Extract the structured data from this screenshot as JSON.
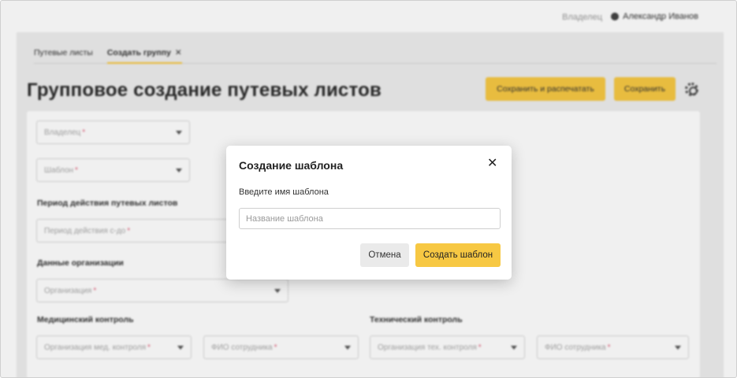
{
  "header": {
    "owner_label": "Владелец",
    "user_name": "Александр Иванов"
  },
  "tabs": [
    {
      "label": "Путевые листы"
    },
    {
      "label": "Создать группу",
      "close": "✕"
    }
  ],
  "page": {
    "title": "Групповое создание путевых листов",
    "save_print_label": "Сохранить и распечатать",
    "save_label": "Сохранить"
  },
  "form": {
    "owner_placeholder": "Владелец",
    "template_placeholder": "Шаблон",
    "period_section": "Период действия путевых листов",
    "period_placeholder": "Период действия с-до",
    "org_section": "Данные организации",
    "org_placeholder": "Организация",
    "med_section": "Медицинский контроль",
    "med_org_placeholder": "Организация мед. контроля",
    "med_employee_placeholder": "ФИО сотрудника",
    "tech_section": "Технический контроль",
    "tech_org_placeholder": "Организация тех. контроля",
    "tech_employee_placeholder": "ФИО сотрудника",
    "required_mark": "*"
  },
  "modal": {
    "title": "Создание шаблона",
    "close_glyph": "✕",
    "label": "Введите имя шаблона",
    "input_placeholder": "Название шаблона",
    "input_value": "",
    "cancel_label": "Отмена",
    "create_label": "Создать шаблон"
  },
  "colors": {
    "accent": "#f7c843",
    "required": "#e0607a",
    "panel_bg": "#ededed"
  },
  "icons": {
    "user": "globe-icon",
    "settings": "gear-icon",
    "dropdown": "chevron-down-icon",
    "close": "close-icon"
  }
}
